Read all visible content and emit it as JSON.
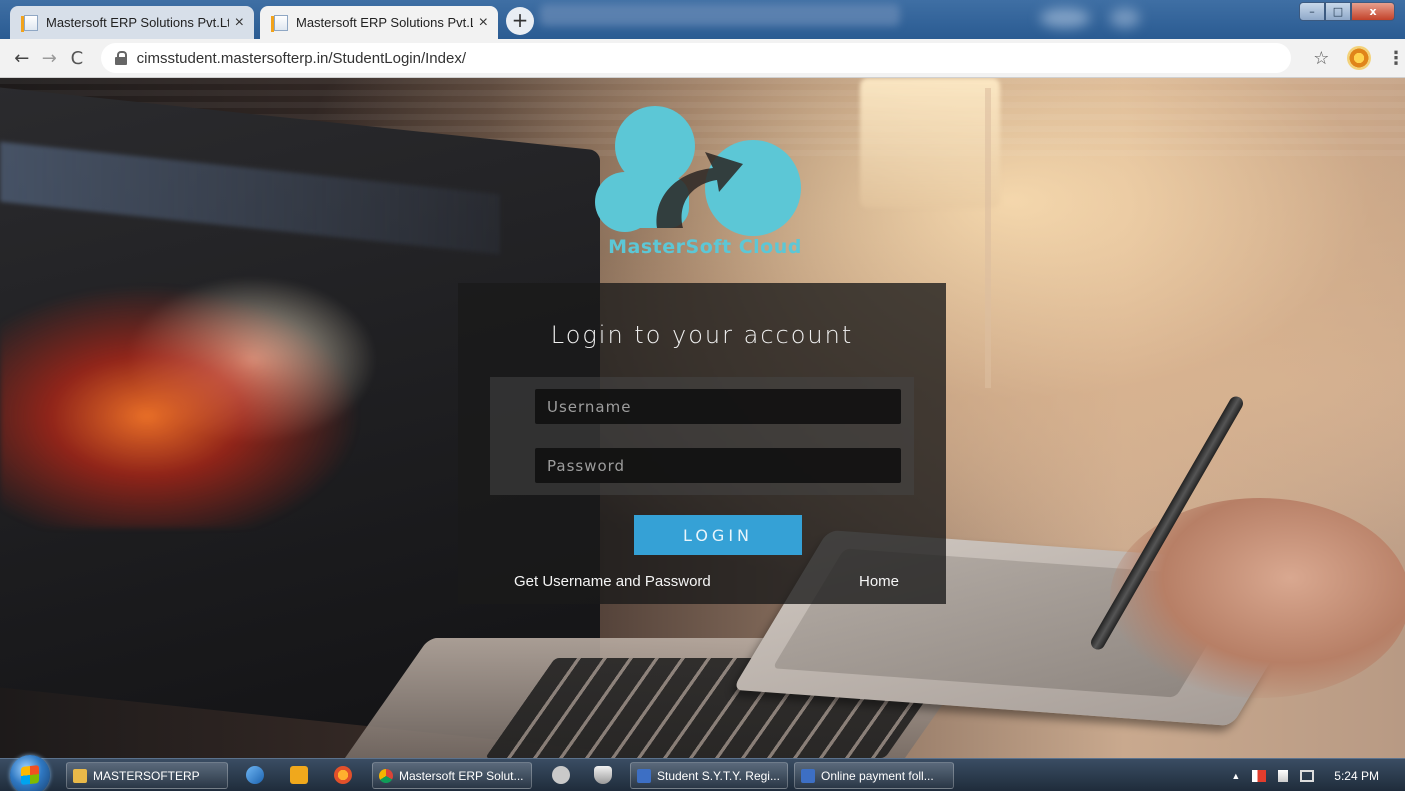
{
  "browser": {
    "tabs": [
      {
        "title": "Mastersoft ERP Solutions Pvt.Ltd",
        "close": "×"
      },
      {
        "title": "Mastersoft ERP Solutions Pvt.Ltd",
        "close": "×"
      }
    ],
    "new_tab": "+",
    "url": "cimsstudent.mastersofterp.in/StudentLogin/Index/",
    "nav": {
      "back": "←",
      "forward": "→",
      "reload": "C"
    },
    "bookmark_star": "☆",
    "menu": "⋮",
    "window_controls": {
      "minimize": "–",
      "maximize": "□",
      "close": "x"
    }
  },
  "page": {
    "logo_text": "MasterSoft Cloud",
    "login": {
      "title": "Login to your account",
      "username_placeholder": "Username",
      "password_placeholder": "Password",
      "login_button": "LOGIN",
      "get_credentials_link": "Get Username and Password",
      "home_link": "Home"
    },
    "colors": {
      "logo": "#5cc7d6",
      "button": "#35a1d6"
    }
  },
  "taskbar": {
    "items": [
      {
        "label": "MASTERSOFTERP",
        "icon": "folder-icon"
      },
      {
        "label": "Mastersoft ERP Solut...",
        "icon": "chrome-icon"
      },
      {
        "label": "Student S.Y.T.Y. Regi...",
        "icon": "document-icon"
      },
      {
        "label": "Online payment foll...",
        "icon": "document-icon"
      }
    ],
    "clock": "5:24 PM"
  }
}
